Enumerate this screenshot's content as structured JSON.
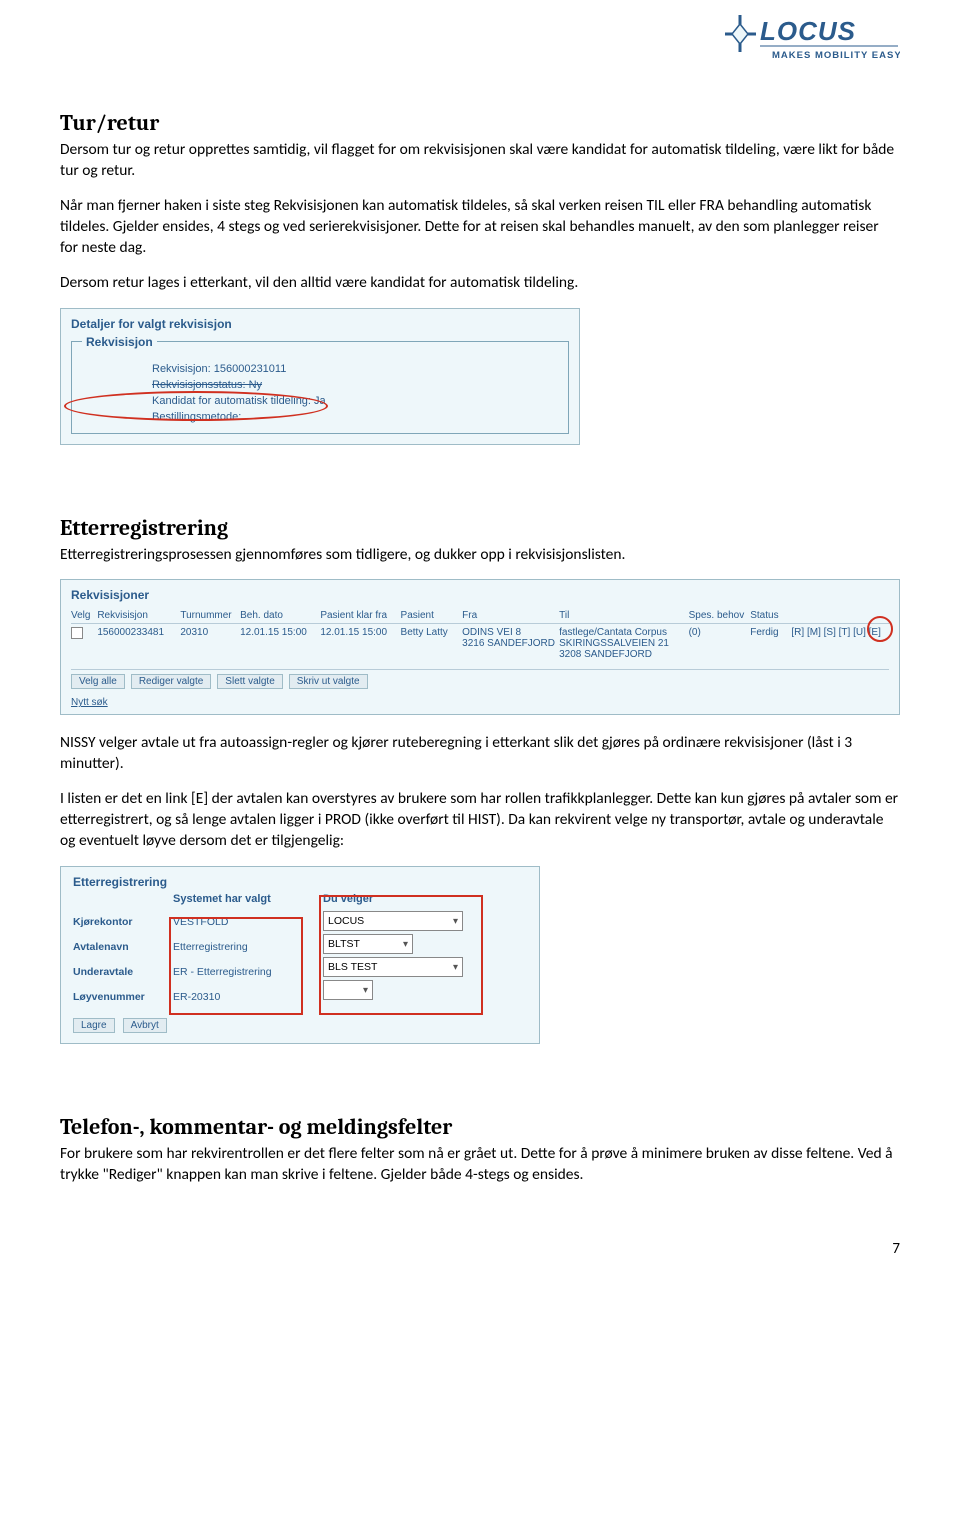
{
  "logo": {
    "brand": "LOCUS",
    "tagline": "MAKES MOBILITY EASY"
  },
  "sec1": {
    "title": "Tur/retur",
    "p1": "Dersom tur og retur opprettes samtidig, vil flagget for om rekvisisjonen skal være kandidat for automatisk tildeling, være likt for både tur og retur.",
    "p2": "Når man fjerner haken i siste steg Rekvisisjonen kan automatisk tildeles, så skal verken reisen TIL eller FRA behandling automatisk tildeles. Gjelder ensides, 4 stegs og ved serierekvisisjoner. Dette for at reisen skal behandles manuelt, av den som planlegger reiser for neste dag.",
    "p3": "Dersom retur lages i etterkant, vil den alltid være kandidat for automatisk tildeling."
  },
  "shot1": {
    "header": "Detaljer for valgt rekvisisjon",
    "legend": "Rekvisisjon",
    "r1": "Rekvisisjon: 156000231011",
    "r2": "Rekvisisjonsstatus: Ny",
    "r3": "Kandidat for automatisk tildeling: Ja",
    "r4": "Bestillingsmetode:"
  },
  "sec2": {
    "title": "Etterregistrering",
    "p1": "Etterregistreringsprosessen gjennomføres som tidligere, og dukker opp i rekvisisjonslisten.",
    "p2": "NISSY velger avtale ut fra autoassign-regler og kjører ruteberegning i etterkant slik det gjøres på ordinære rekvisisjoner (låst i 3 minutter).",
    "p3": "I listen er det en link [E] der avtalen kan overstyres av brukere som har rollen trafikkplanlegger. Dette kan kun gjøres på avtaler som er etterregistrert, og så lenge avtalen ligger i PROD (ikke overført til HIST). Da kan rekvirent velge ny transportør, avtale og underavtale og eventuelt løyve dersom det er tilgjengelig:"
  },
  "shot2": {
    "title": "Rekvisisjoner",
    "headers": {
      "velg": "Velg",
      "rekv": "Rekvisisjon",
      "tur": "Turnummer",
      "beh": "Beh. dato",
      "klar": "Pasient klar fra",
      "pas": "Pasient",
      "fra": "Fra",
      "til": "Til",
      "spes": "Spes. behov",
      "stat": "Status",
      "act": ""
    },
    "row": {
      "rekv": "156000233481",
      "tur": "20310",
      "beh": "12.01.15 15:00",
      "klar": "12.01.15 15:00",
      "pas": "Betty Latty",
      "fra": "ODINS VEI 8\n3216 SANDEFJORD",
      "til": "fastlege/Cantata Corpus\nSKIRINGSSALVEIEN 21\n3208 SANDEFJORD",
      "spes": "(0)",
      "stat": "Ferdig",
      "act": "[R] [M] [S] [T] [U] [E]"
    },
    "buttons": {
      "velgalle": "Velg alle",
      "rediger": "Rediger valgte",
      "slett": "Slett valgte",
      "skriv": "Skriv ut valgte"
    },
    "nytt": "Nytt søk"
  },
  "shot3": {
    "title": "Etterregistrering",
    "h_sys": "Systemet har valgt",
    "h_du": "Du velger",
    "labels": {
      "kontor": "Kjørekontor",
      "avtale": "Avtalenavn",
      "under": "Underavtale",
      "loyve": "Løyvenummer"
    },
    "sys": {
      "kontor": "VESTFOLD",
      "avtale": "Etterregistrering",
      "under": "ER - Etterregistrering",
      "loyve": "ER-20310"
    },
    "du": {
      "kontor": "LOCUS",
      "avtale": "BLTST",
      "under": "BLS TEST",
      "loyve": ""
    },
    "btn_lagre": "Lagre",
    "btn_avbryt": "Avbryt"
  },
  "sec3": {
    "title": "Telefon-, kommentar- og meldingsfelter",
    "p1": "For brukere som har rekvirentrollen er det flere felter som nå er grået ut. Dette for å prøve å minimere bruken av disse feltene. Ved å trykke \"Rediger\" knappen kan man skrive i feltene. Gjelder både 4-stegs og ensides."
  },
  "page": "7"
}
